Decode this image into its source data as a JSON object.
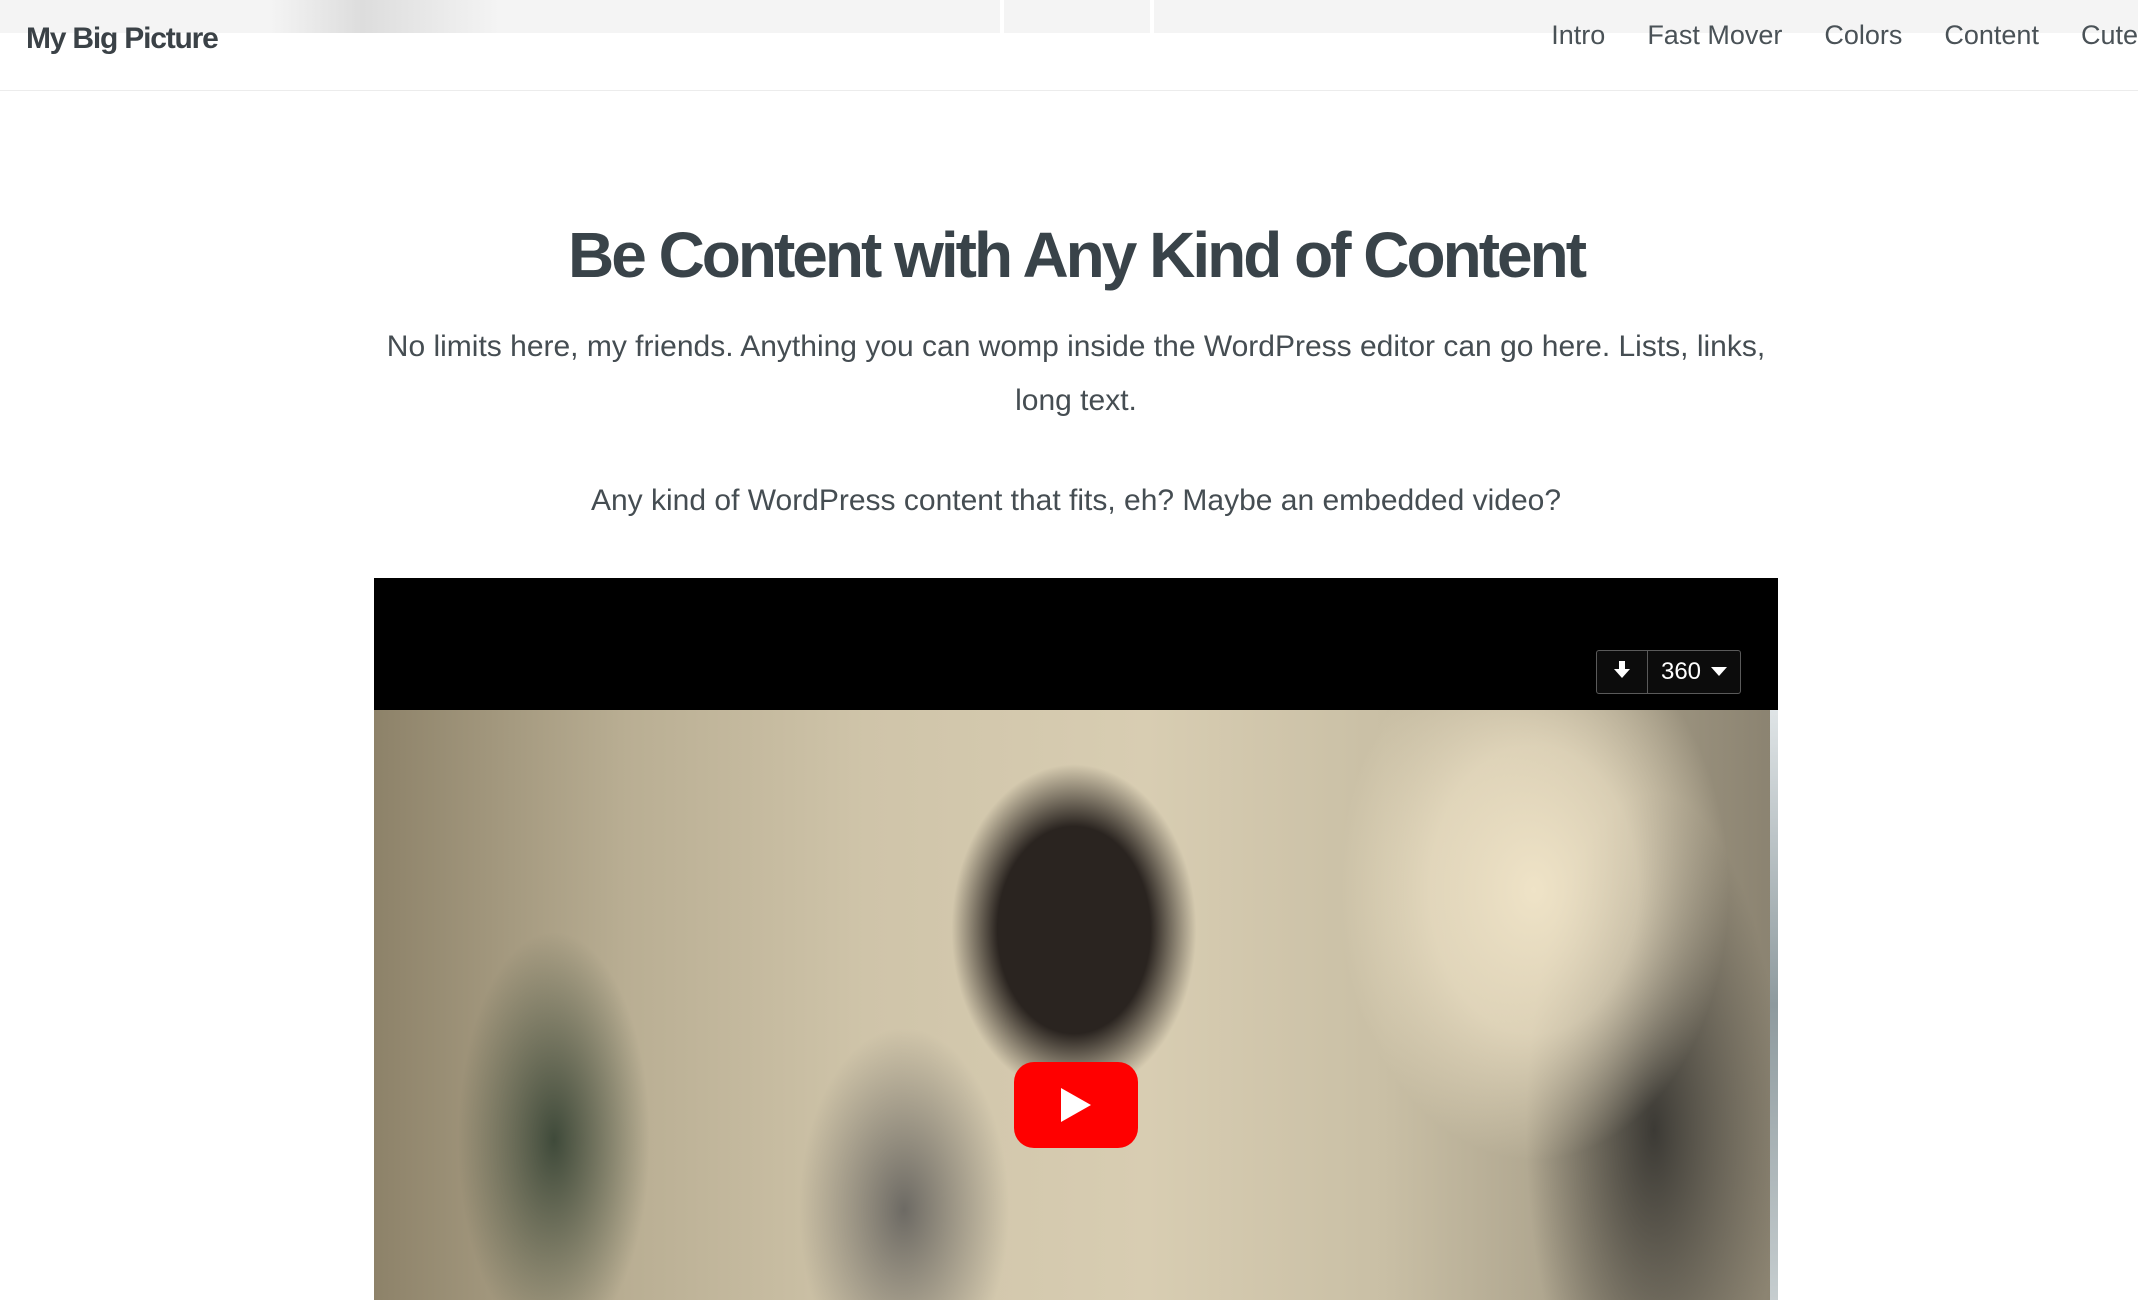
{
  "site": {
    "brand": "My Big Picture"
  },
  "nav": {
    "items": [
      "Intro",
      "Fast Mover",
      "Colors",
      "Content",
      "Cute"
    ]
  },
  "section": {
    "title": "Be Content with Any Kind of Content",
    "paragraph_1": "No limits here, my friends. Anything you can womp inside the WordPress editor can go here. Lists, links, long text.",
    "paragraph_2": "Any kind of WordPress content that fits, eh? Maybe an embedded video?"
  },
  "video": {
    "quality": "360",
    "icons": {
      "download": "download-icon",
      "quality_dropdown": "chevron-down-icon",
      "play": "play-icon"
    },
    "colors": {
      "play_button": "#ff0000",
      "player_background": "#000000"
    }
  },
  "colors": {
    "text": "#3b4247",
    "background": "#ffffff"
  }
}
